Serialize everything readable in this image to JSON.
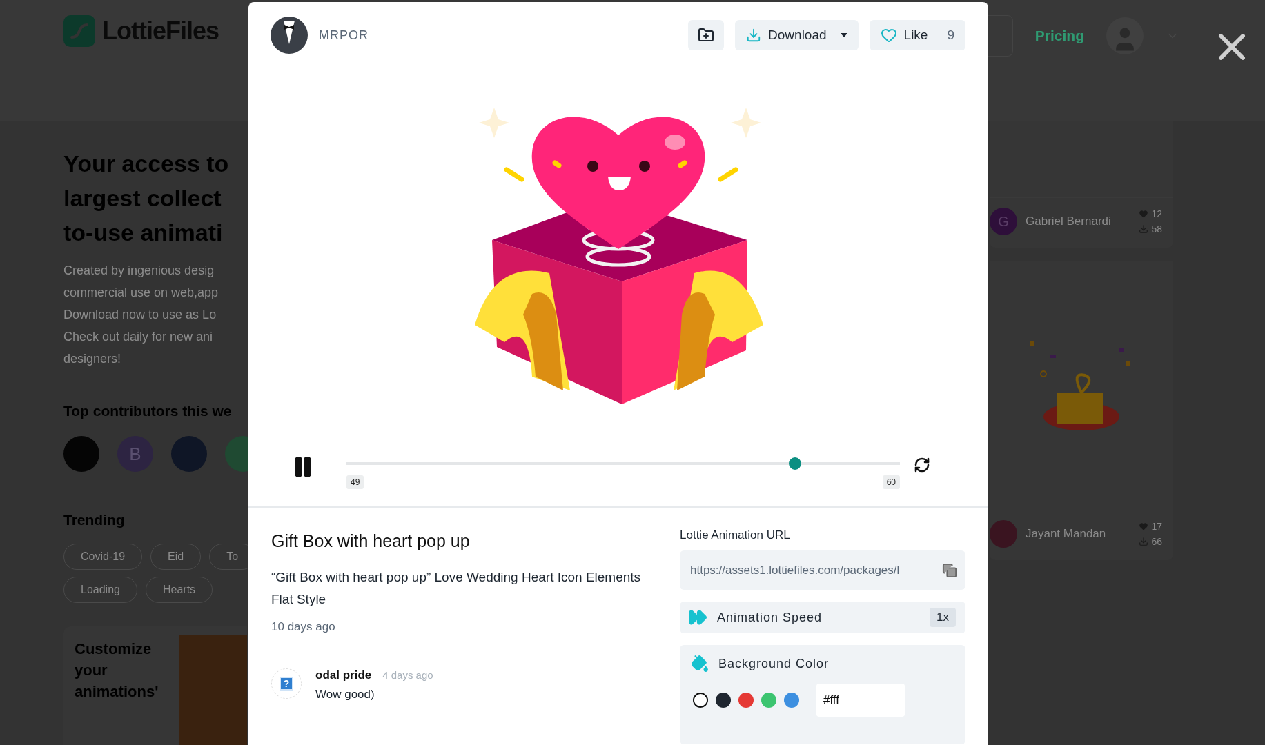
{
  "header": {
    "logo": "LottieFiles",
    "nav_link": "Pricing"
  },
  "hero": {
    "heading_lines": [
      "Your access to",
      "largest collect",
      "to-use animati"
    ],
    "description_lines": [
      "Created by ingenious desig",
      "commercial use on web,app",
      "Download now to use as Lo",
      "Check out daily for new ani",
      "designers!"
    ]
  },
  "contributors": {
    "title": "Top contributors this we",
    "avatars": [
      {
        "kind": "logo",
        "color": "#050505"
      },
      {
        "kind": "letter",
        "text": "B",
        "color": "#2d2442"
      },
      {
        "kind": "logo",
        "color": "#0f1626"
      },
      {
        "kind": "photo",
        "color": "#1f4a32"
      }
    ]
  },
  "trending": {
    "title": "Trending",
    "tags": [
      "Covid-19",
      "Eid",
      "To",
      "Loading",
      "Hearts"
    ]
  },
  "promo_card": {
    "title": "Customize your animations'"
  },
  "side_cards": [
    {
      "kind": "blank",
      "author": "Gabriel Bernardi",
      "avatar_initial": "G",
      "likes": "12",
      "downloads": "58"
    },
    {
      "kind": "gift",
      "author": "Jayant Mandan",
      "likes": "17",
      "downloads": "66"
    }
  ],
  "modal": {
    "author": "MRPOR",
    "download_label": "Download",
    "like_label": "Like",
    "like_count": "9",
    "player": {
      "playing": true,
      "level": 0.81,
      "start_frame": "49",
      "end_frame": "60"
    },
    "title": "Gift Box with heart pop up",
    "description": "“Gift Box with heart pop up” Love Wedding Heart Icon Elements Flat Style",
    "posted": "10 days ago",
    "comments": [
      {
        "author": "odal pride",
        "time": "4 days ago",
        "text": "Wow good)",
        "avatar_glyph": "?"
      }
    ],
    "url_label": "Lottie Animation URL",
    "url": "https://assets1.lottiefiles.com/packages/l",
    "speed_label": "Animation Speed",
    "speed": "1x",
    "background_label": "Background Color",
    "swatches": [
      {
        "color": "#ffffff"
      },
      {
        "color": "#1f2630"
      },
      {
        "color": "#e53935"
      },
      {
        "color": "#3cc470"
      },
      {
        "color": "#3d8fe0"
      }
    ],
    "background_value": "#fff"
  }
}
